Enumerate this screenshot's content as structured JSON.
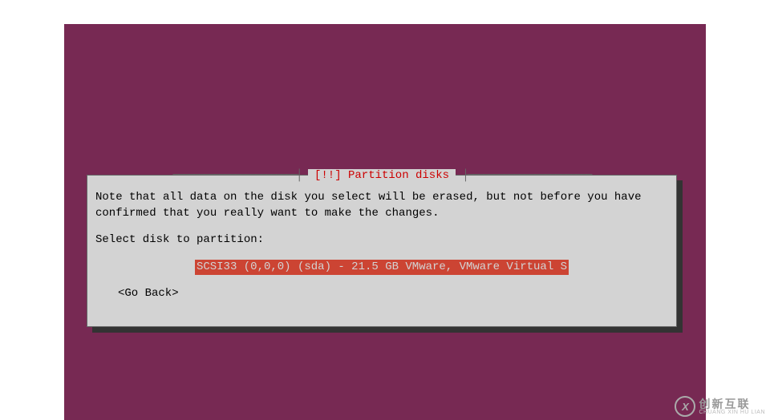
{
  "dialog": {
    "title": "[!!] Partition disks",
    "note_text": "Note that all data on the disk you select will be erased, but not before you have confirmed that you really want to make the changes.",
    "select_prompt": "Select disk to partition:",
    "disk_option": "SCSI33 (0,0,0) (sda) - 21.5 GB VMware, VMware Virtual S",
    "go_back": "<Go Back>"
  },
  "watermark": {
    "icon_letter": "X",
    "cn": "创新互联",
    "en": "CHUANG XIN HU LIAN"
  }
}
